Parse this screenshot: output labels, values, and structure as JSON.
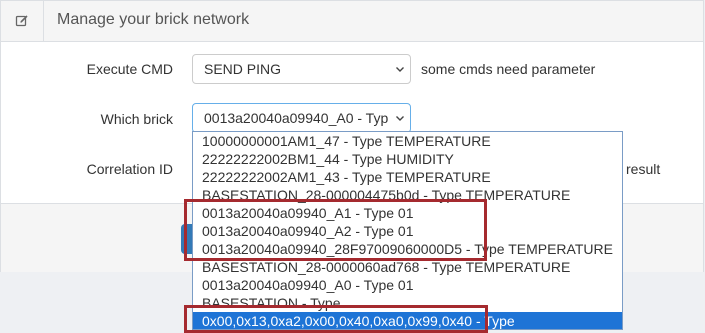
{
  "header": {
    "title": "Manage your brick network",
    "icon": "edit-icon"
  },
  "form": {
    "execute_cmd": {
      "label": "Execute CMD",
      "value": "SEND PING",
      "hint": "some cmds need parameter"
    },
    "which_brick": {
      "label": "Which brick",
      "value": "0013a20040a09940_A0 - Typ"
    },
    "correlation_id": {
      "label": "Correlation ID",
      "hint": "result"
    }
  },
  "dropdown": {
    "options": [
      "10000000001AM1_47 - Type TEMPERATURE",
      "22222222002BM1_44 - Type HUMIDITY",
      "22222222002AM1_43 - Type TEMPERATURE",
      "BASESTATION_28-000004475b0d - Type TEMPERATURE",
      "0013a20040a09940_A1 - Type 01",
      "0013a20040a09940_A2 - Type 01",
      "0013a20040a09940_28F97009060000D5 - Type TEMPERATURE",
      "BASESTATION_28-0000060ad768 - Type TEMPERATURE",
      "0013a20040a09940_A0 - Type 01",
      "BASESTATION - Type",
      "0x00,0x13,0xa2,0x00,0x40,0xa0,0x99,0x40 - Type"
    ],
    "selected_index": 10
  },
  "annotations": {
    "highlight_color": "#a52a2f"
  },
  "colors": {
    "accent": "#337ab7",
    "selection": "#1e74d6"
  }
}
